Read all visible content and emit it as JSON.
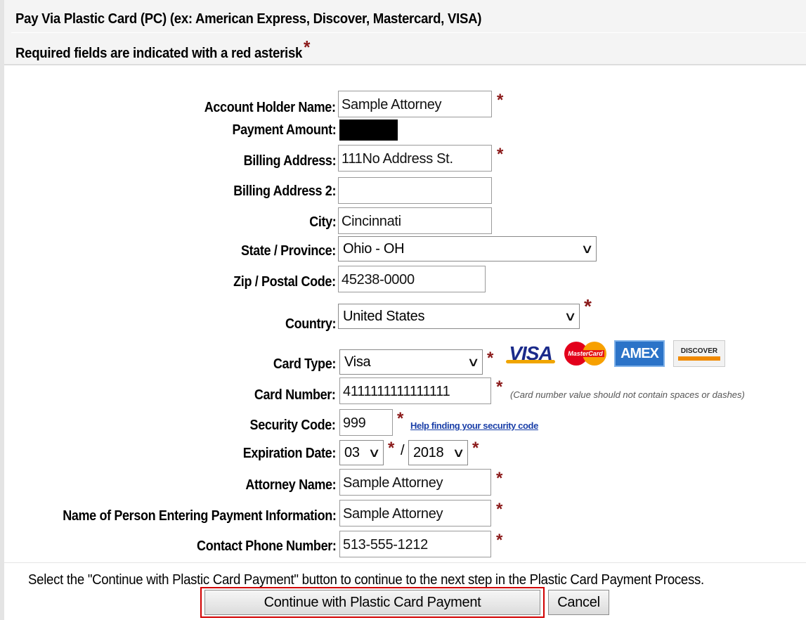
{
  "header": {
    "title": "Pay Via Plastic Card (PC) (ex: American Express, Discover, Mastercard, VISA)",
    "required_note": "Required fields are indicated with a red asterisk",
    "required_marker": "*"
  },
  "form": {
    "account_holder_name": {
      "label": "Account Holder Name:",
      "value": "Sample Attorney"
    },
    "payment_amount": {
      "label": "Payment Amount:"
    },
    "billing_address": {
      "label": "Billing Address:",
      "value": "111No Address St."
    },
    "billing_address_2": {
      "label": "Billing Address 2:",
      "value": ""
    },
    "city": {
      "label": "City:",
      "value": "Cincinnati"
    },
    "state": {
      "label": "State / Province:",
      "value": "Ohio - OH"
    },
    "zip": {
      "label": "Zip / Postal Code:",
      "value": "45238-0000"
    },
    "country": {
      "label": "Country:",
      "value": "United States"
    },
    "card_type": {
      "label": "Card Type:",
      "value": "Visa"
    },
    "card_number": {
      "label": "Card Number:",
      "value": "4111111111111111",
      "note": "(Card number value should not contain spaces or dashes)"
    },
    "security_code": {
      "label": "Security Code:",
      "value": "999",
      "help_link": "Help finding your security code"
    },
    "expiration": {
      "label": "Expiration Date:",
      "month": "03",
      "year": "2018",
      "separator": "/"
    },
    "attorney_name": {
      "label": "Attorney Name:",
      "value": "Sample Attorney"
    },
    "entering_person": {
      "label": "Name of Person Entering Payment Information:",
      "value": "Sample Attorney"
    },
    "phone": {
      "label": "Contact Phone Number:",
      "value": "513-555-1212"
    }
  },
  "card_logos": {
    "visa": "VISA",
    "mastercard": "MasterCard",
    "amex": "AMEX",
    "discover": "DISCOVER"
  },
  "footer": {
    "instruction": "Select the \"Continue with Plastic Card Payment\" button to continue to the next step in the Plastic Card Payment Process.",
    "continue_label": "Continue with Plastic Card Payment",
    "cancel_label": "Cancel"
  },
  "colors": {
    "asterisk": "#8b1a1a",
    "link": "#1a3fa8",
    "highlight_frame": "#d10000",
    "header_bg": "#f4f4f4"
  }
}
